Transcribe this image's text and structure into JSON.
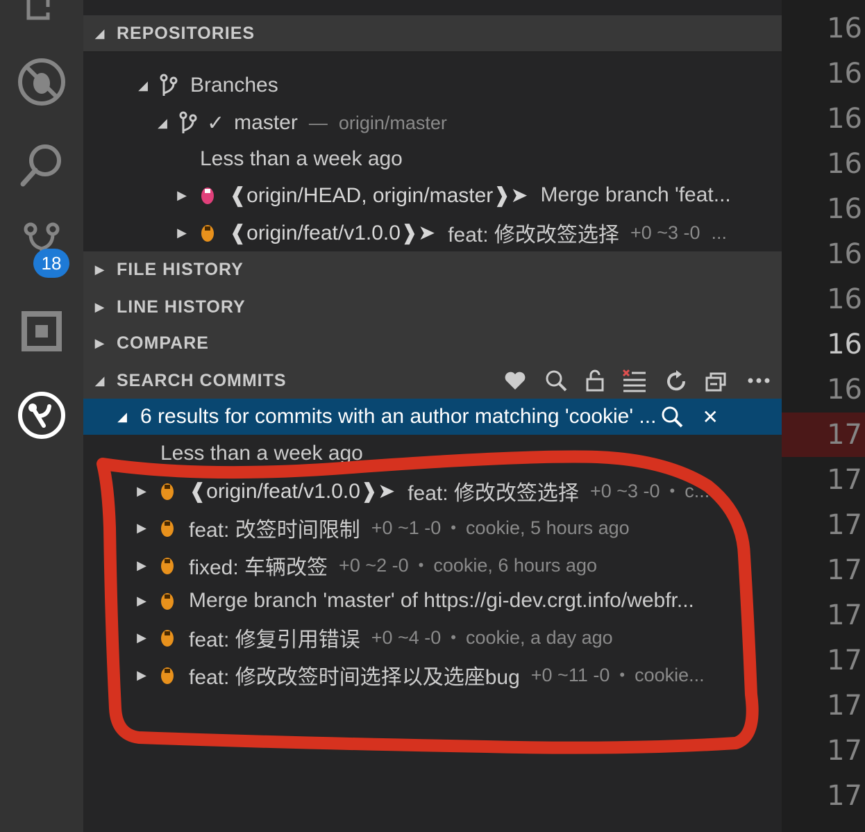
{
  "activity_bar": {
    "icons": [
      "files-icon",
      "debug-icon",
      "search-icon",
      "source-control-icon",
      "extensions-icon",
      "gitlens-icon"
    ],
    "scm_badge": "18"
  },
  "repositories": {
    "header": "REPOSITORIES",
    "branches_label": "Branches",
    "branch": {
      "name": "master",
      "separator": "—",
      "upstream": "origin/master"
    },
    "date_group": "Less than a week ago",
    "commits": [
      {
        "tag": "❰origin/HEAD, origin/master❱➤",
        "message": "Merge branch 'feat...",
        "stats": "",
        "meta": ""
      },
      {
        "tag": "❰origin/feat/v1.0.0❱➤",
        "message": "feat:  修改改签选择",
        "stats": "+0 ~3 -0",
        "meta": "..."
      }
    ]
  },
  "sections": {
    "file_history": "FILE HISTORY",
    "line_history": "LINE HISTORY",
    "compare": "COMPARE",
    "search_commits": "SEARCH COMMITS"
  },
  "search_toolbar": [
    "heart-icon",
    "search-icon",
    "unlock-icon",
    "clear-list-icon",
    "refresh-icon",
    "collapse-all-icon",
    "more-icon"
  ],
  "search_results": {
    "title": "6 results for commits with an author matching 'cookie' ...",
    "date_group": "Less than a week ago",
    "commits": [
      {
        "tag": "❰origin/feat/v1.0.0❱➤",
        "message": "feat:  修改改签选择",
        "stats": "+0 ~3 -0",
        "meta": "c..."
      },
      {
        "tag": "",
        "message": "feat:  改签时间限制",
        "stats": "+0 ~1 -0",
        "meta": "cookie, 5 hours ago"
      },
      {
        "tag": "",
        "message": "fixed:  车辆改签",
        "stats": "+0 ~2 -0",
        "meta": "cookie, 6 hours ago"
      },
      {
        "tag": "",
        "message": "Merge branch 'master' of https://gi-dev.crgt.info/webfr...",
        "stats": "",
        "meta": ""
      },
      {
        "tag": "",
        "message": "feat:  修复引用错误",
        "stats": "+0 ~4 -0",
        "meta": "cookie, a day ago"
      },
      {
        "tag": "",
        "message": "feat:  修改改签时间选择以及选座bug",
        "stats": "+0 ~11 -0",
        "meta": "cookie..."
      }
    ]
  },
  "editor": {
    "line_numbers": [
      "16",
      "16",
      "16",
      "16",
      "16",
      "16",
      "16",
      "16",
      "16",
      "17",
      "17",
      "17",
      "17",
      "17",
      "17",
      "17",
      "17",
      "17"
    ]
  },
  "colors": {
    "activity_bar": "#333333",
    "sidebar": "#252526",
    "selection": "#094771",
    "badge": "#1e7ad6",
    "annotation": "#d6321f"
  }
}
